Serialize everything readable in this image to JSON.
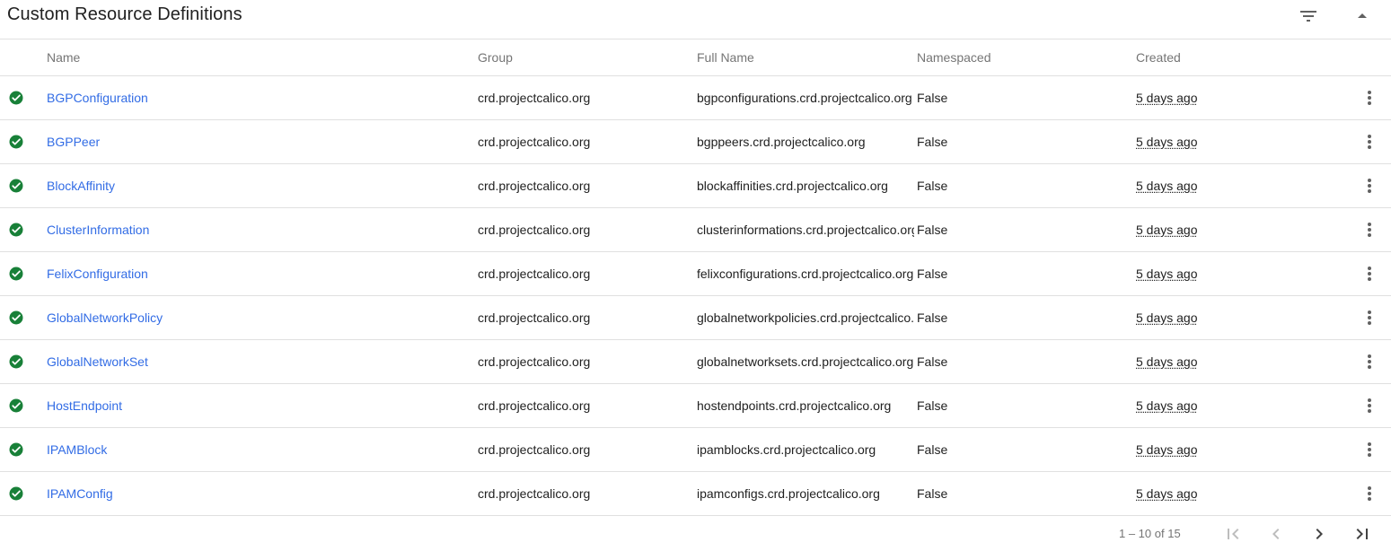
{
  "card": {
    "title": "Custom Resource Definitions",
    "filter_icon": "filter-list-icon",
    "collapse_icon": "expand-less-icon"
  },
  "columns": {
    "name": "Name",
    "group": "Group",
    "full_name": "Full Name",
    "namespaced": "Namespaced",
    "created": "Created"
  },
  "rows": [
    {
      "name": "BGPConfiguration",
      "group": "crd.projectcalico.org",
      "full_name": "bgpconfigurations.crd.projectcalico.org",
      "namespaced": "False",
      "created": "5 days ago",
      "status_icon": "check-circle-icon"
    },
    {
      "name": "BGPPeer",
      "group": "crd.projectcalico.org",
      "full_name": "bgppeers.crd.projectcalico.org",
      "namespaced": "False",
      "created": "5 days ago",
      "status_icon": "check-circle-icon"
    },
    {
      "name": "BlockAffinity",
      "group": "crd.projectcalico.org",
      "full_name": "blockaffinities.crd.projectcalico.org",
      "namespaced": "False",
      "created": "5 days ago",
      "status_icon": "check-circle-icon"
    },
    {
      "name": "ClusterInformation",
      "group": "crd.projectcalico.org",
      "full_name": "clusterinformations.crd.projectcalico.org",
      "namespaced": "False",
      "created": "5 days ago",
      "status_icon": "check-circle-icon"
    },
    {
      "name": "FelixConfiguration",
      "group": "crd.projectcalico.org",
      "full_name": "felixconfigurations.crd.projectcalico.org",
      "namespaced": "False",
      "created": "5 days ago",
      "status_icon": "check-circle-icon"
    },
    {
      "name": "GlobalNetworkPolicy",
      "group": "crd.projectcalico.org",
      "full_name": "globalnetworkpolicies.crd.projectcalico.org",
      "namespaced": "False",
      "created": "5 days ago",
      "status_icon": "check-circle-icon"
    },
    {
      "name": "GlobalNetworkSet",
      "group": "crd.projectcalico.org",
      "full_name": "globalnetworksets.crd.projectcalico.org",
      "namespaced": "False",
      "created": "5 days ago",
      "status_icon": "check-circle-icon"
    },
    {
      "name": "HostEndpoint",
      "group": "crd.projectcalico.org",
      "full_name": "hostendpoints.crd.projectcalico.org",
      "namespaced": "False",
      "created": "5 days ago",
      "status_icon": "check-circle-icon"
    },
    {
      "name": "IPAMBlock",
      "group": "crd.projectcalico.org",
      "full_name": "ipamblocks.crd.projectcalico.org",
      "namespaced": "False",
      "created": "5 days ago",
      "status_icon": "check-circle-icon"
    },
    {
      "name": "IPAMConfig",
      "group": "crd.projectcalico.org",
      "full_name": "ipamconfigs.crd.projectcalico.org",
      "namespaced": "False",
      "created": "5 days ago",
      "status_icon": "check-circle-icon"
    }
  ],
  "pagination": {
    "range_label": "1 – 10 of 15",
    "first_icon": "first-page-icon",
    "prev_icon": "chevron-left-icon",
    "next_icon": "chevron-right-icon",
    "last_icon": "last-page-icon"
  },
  "colors": {
    "success": "#188038",
    "link": "#326ce5",
    "header_text": "#757575",
    "divider": "#e0e0e0"
  }
}
